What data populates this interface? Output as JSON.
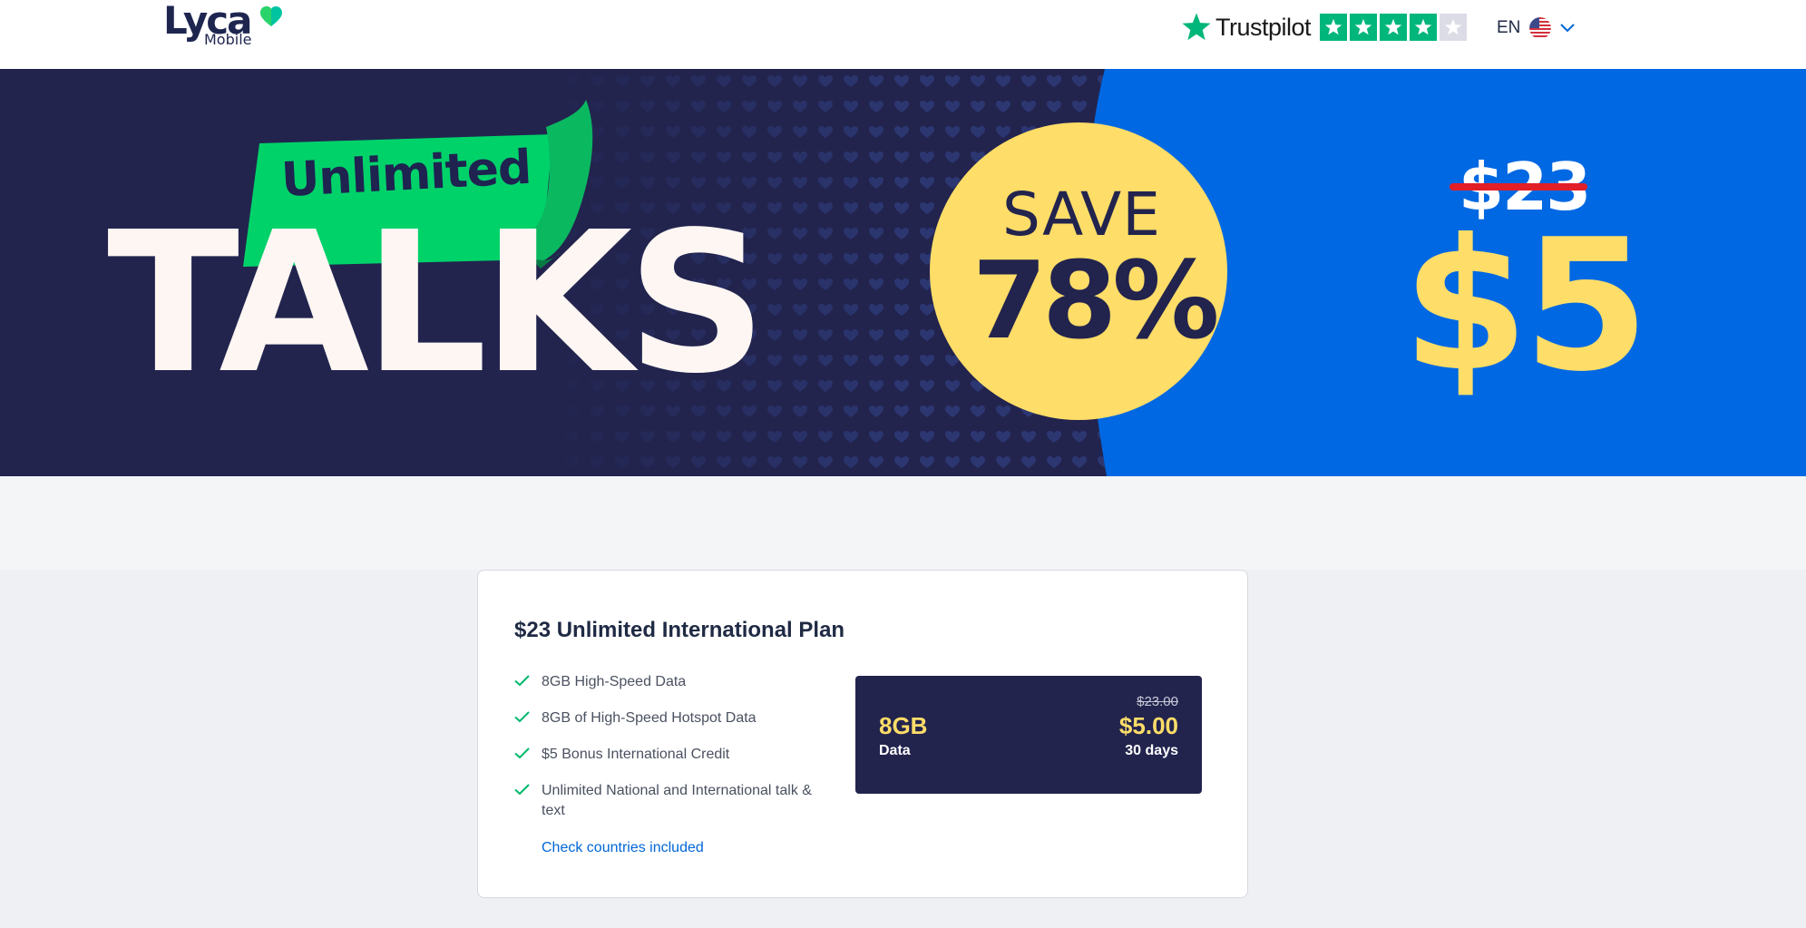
{
  "header": {
    "logo_main": "Lyca",
    "logo_sub": "Mobile",
    "trustpilot_name": "Trustpilot",
    "trustpilot_rating": 4.5,
    "language_code": "EN"
  },
  "hero": {
    "ribbon_text": "Unlimited",
    "headline": "TALKS",
    "save_word": "SAVE",
    "save_percent": "78%",
    "old_price": "$23",
    "new_price": "$5"
  },
  "plan": {
    "title": "$23 Unlimited International Plan",
    "features": [
      "8GB High-Speed Data",
      "8GB of High-Speed Hotspot Data",
      "$5 Bonus International Credit",
      "Unlimited National and International talk & text"
    ],
    "check_countries_link": "Check countries included",
    "data_amount": "8GB",
    "data_label": "Data",
    "old_price": "$23.00",
    "new_price": "$5.00",
    "duration": "30 days"
  },
  "colors": {
    "navy": "#22244e",
    "hero_blue": "#0068e2",
    "yellow": "#fedd68",
    "green": "#00d26a",
    "trustpilot_green": "#00b67a",
    "link_blue": "#0066d6",
    "strike_red": "#e21f26"
  },
  "icons": {
    "logo_heart": "heart-icon",
    "trustpilot_star": "star-icon",
    "flag": "us-flag-icon",
    "dropdown": "chevron-down-icon",
    "feature_bullet": "check-icon"
  }
}
